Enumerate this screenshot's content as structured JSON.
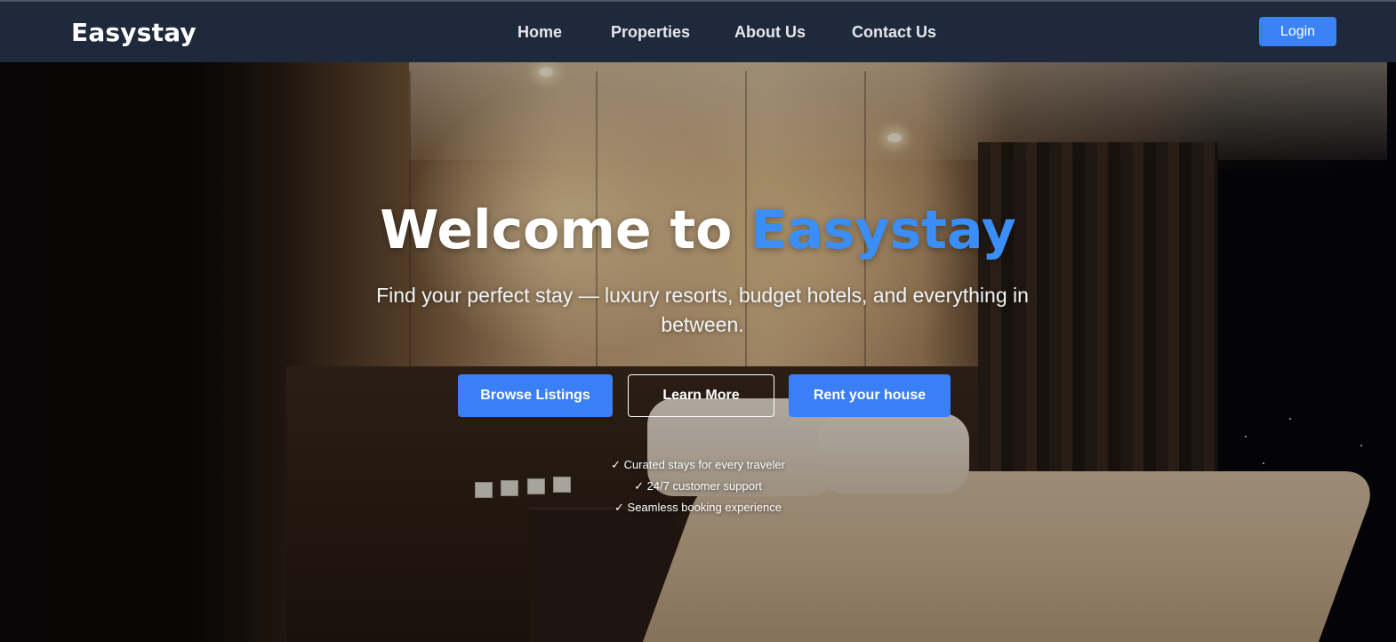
{
  "brand": {
    "name": "Easystay"
  },
  "nav": {
    "links": [
      "Home",
      "Properties",
      "About Us",
      "Contact Us"
    ],
    "login_label": "Login"
  },
  "hero": {
    "title_prefix": "Welcome to ",
    "title_accent": "Easystay",
    "subtitle": "Find your perfect stay — luxury resorts, budget hotels, and everything in between.",
    "buttons": {
      "browse": "Browse Listings",
      "learn": "Learn More",
      "rent": "Rent your house"
    },
    "features": [
      "✓ Curated stays for every traveler",
      "✓ 24/7 customer support",
      "✓ Seamless booking experience"
    ]
  },
  "colors": {
    "navbar_bg": "#1e293b",
    "accent": "#3b82f6"
  }
}
